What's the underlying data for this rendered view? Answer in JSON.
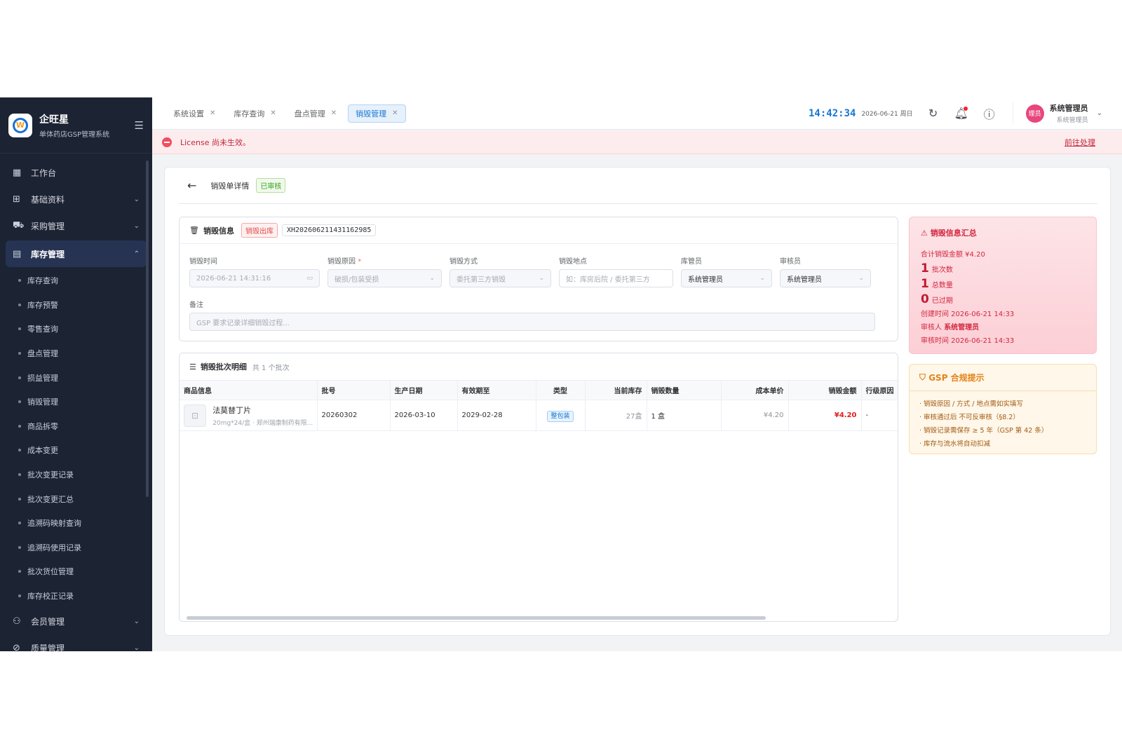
{
  "sidebar": {
    "brand_name": "企旺星",
    "brand_sub": "单体药店GSP管理系统",
    "items": [
      {
        "label": "工作台"
      },
      {
        "label": "基础资料"
      },
      {
        "label": "采购管理"
      },
      {
        "label": "库存管理"
      },
      {
        "label": "会员管理"
      },
      {
        "label": "质量管理"
      }
    ],
    "subitems": [
      "库存查询",
      "库存预警",
      "零售查询",
      "盘点管理",
      "损益管理",
      "销毁管理",
      "商品拆零",
      "成本变更",
      "批次变更记录",
      "批次变更汇总",
      "追溯码映射查询",
      "追溯码使用记录",
      "批次货位管理",
      "库存校正记录"
    ]
  },
  "topbar": {
    "tabs": [
      {
        "label": "系统设置"
      },
      {
        "label": "库存查询"
      },
      {
        "label": "盘点管理"
      },
      {
        "label": "销毁管理"
      }
    ],
    "clock": "14:42:34",
    "date": "2026-06-21 周日",
    "user_name": "系统管理员",
    "user_role": "系统管理员",
    "avatar_text": "理员"
  },
  "license": {
    "message": "License 尚未生效。",
    "action": "前往处理"
  },
  "detail": {
    "title": "销毁单详情",
    "status": "已审核"
  },
  "info": {
    "title": "销毁信息",
    "type_tag": "销毁出库",
    "order_no": "XH202606211431162985",
    "fields": {
      "time_label": "销毁时间",
      "time_value": "2026-06-21 14:31:16",
      "reason_label": "销毁原因",
      "reason_value": "破损/包装受损",
      "method_label": "销毁方式",
      "method_value": "委托第三方销毁",
      "place_label": "销毁地点",
      "place_placeholder": "如：库房后院 / 委托第三方",
      "keeper_label": "库管员",
      "keeper_value": "系统管理员",
      "auditor_label": "审核员",
      "auditor_value": "系统管理员",
      "remark_label": "备注",
      "remark_placeholder": "GSP 要求记录详细销毁过程..."
    }
  },
  "batch": {
    "title": "销毁批次明细",
    "count": "共 1 个批次",
    "columns": [
      "商品信息",
      "批号",
      "生产日期",
      "有效期至",
      "类型",
      "当前库存",
      "销毁数量",
      "成本单价",
      "销毁金额",
      "行级原因"
    ],
    "rows": [
      {
        "name": "法莫替丁片",
        "spec": "20mg*24/盒 · 郑州瑞康制药有限...",
        "batch": "20260302",
        "prod_date": "2026-03-10",
        "expiry": "2029-02-28",
        "type": "整包装",
        "stock": "27盒",
        "qty": "1 盒",
        "unit_cost": "¥4.20",
        "amount": "¥4.20",
        "reason": "-"
      }
    ]
  },
  "summary": {
    "title": "销毁信息汇总",
    "total_label": "合计销毁金额 ¥4.20",
    "batches_num": "1",
    "batches_label": "批次数",
    "qty_num": "1",
    "qty_label": "总数量",
    "expired_num": "0",
    "expired_label": "已过期",
    "created": "创建时间 2026-06-21 14:33",
    "auditor_label": "审核人",
    "auditor_name": "系统管理员",
    "audit_time": "审核时间 2026-06-21 14:33"
  },
  "gsp": {
    "title": "GSP 合规提示",
    "items": [
      "· 销毁原因 / 方式 / 地点需如实填写",
      "· 审核通过后 不可反审核（§8.2）",
      "· 销毁记录需保存 ≥ 5 年（GSP 第 42 条）",
      "· 库存与流水将自动扣减"
    ]
  },
  "colors": {
    "sidebar_bg": "#1c2333",
    "accent": "#1677d2",
    "danger": "#e02020"
  }
}
